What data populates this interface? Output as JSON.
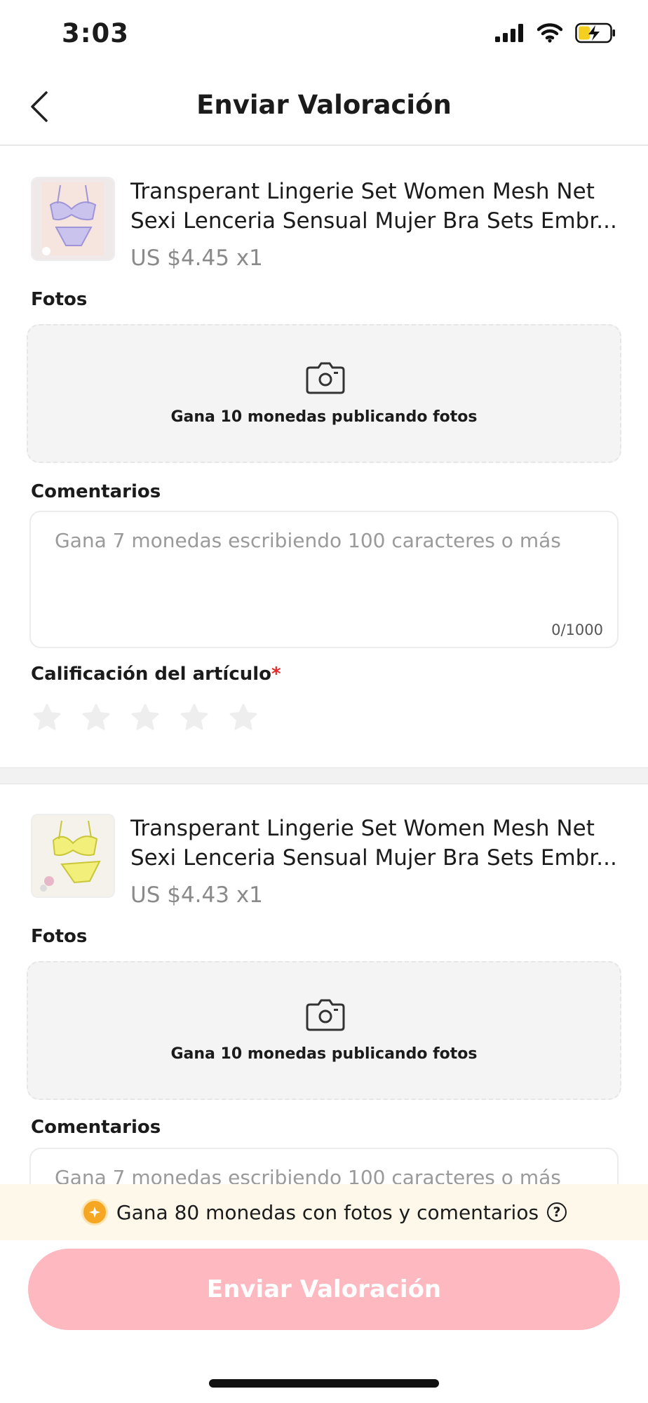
{
  "status_bar": {
    "time": "3:03"
  },
  "navbar": {
    "title": "Enviar Valoración"
  },
  "items": [
    {
      "title_line1": "Transperant Lingerie Set Women Mesh Net",
      "title_line2": "Sexi Lenceria Sensual Mujer Bra Sets Embr...",
      "price": "US $4.45 x1",
      "photos_label": "Fotos",
      "photos_prompt": "Gana 10 monedas publicando fotos",
      "comments_label": "Comentarios",
      "comment_placeholder": "Gana 7 monedas escribiendo 100 caracteres o más",
      "char_counter": "0/1000",
      "rating_label": "Calificación del artículo",
      "rating_required_mark": "*",
      "rating_value": 0,
      "rating_max": 5,
      "thumb_color": "#c9c3ee"
    },
    {
      "title_line1": "Transperant Lingerie Set Women Mesh Net",
      "title_line2": "Sexi Lenceria Sensual Mujer Bra Sets Embr...",
      "price": "US $4.43 x1",
      "photos_label": "Fotos",
      "photos_prompt": "Gana 10 monedas publicando fotos",
      "comments_label": "Comentarios",
      "comment_placeholder": "Gana 7 monedas escribiendo 100 caracteres o más",
      "thumb_color": "#f2f07a"
    }
  ],
  "promo": {
    "text": "Gana 80 monedas con fotos y comentarios",
    "icon": "coin-icon",
    "help_icon": "question-circle-icon"
  },
  "submit": {
    "label": "Enviar Valoración",
    "color": "#fdb8c0"
  },
  "colors": {
    "accent_pink": "#fdb8c0",
    "required_red": "#e02a2a",
    "promo_bg": "#fdf8ea"
  }
}
